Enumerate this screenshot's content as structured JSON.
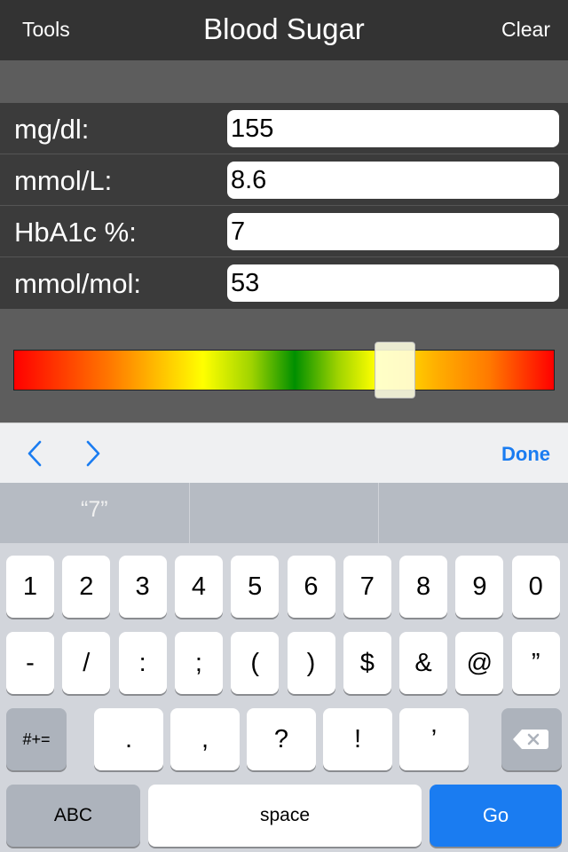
{
  "navbar": {
    "left_label": "Tools",
    "title": "Blood Sugar",
    "right_label": "Clear"
  },
  "rows": [
    {
      "label": "mg/dl:",
      "value": "155"
    },
    {
      "label": "mmol/L:",
      "value": "8.6"
    },
    {
      "label": "HbA1c %:",
      "value": "7"
    },
    {
      "label": "mmol/mol:",
      "value": "53"
    }
  ],
  "gauge": {
    "level_fraction": 0.705
  },
  "accessory": {
    "prev_icon": "chevron-left-icon",
    "next_icon": "chevron-right-icon",
    "done_label": "Done"
  },
  "suggestions": [
    "“7”",
    "",
    ""
  ],
  "keyboard": {
    "row1": [
      "1",
      "2",
      "3",
      "4",
      "5",
      "6",
      "7",
      "8",
      "9",
      "0"
    ],
    "row2": [
      "-",
      "/",
      ":",
      ";",
      "(",
      ")",
      "$",
      "&",
      "@",
      "”"
    ],
    "row3": [
      "#+=",
      ".",
      ",",
      "?",
      "!",
      "’"
    ],
    "delete_icon": "backspace-icon",
    "row4": [
      "ABC",
      "space",
      "Go"
    ]
  },
  "colors": {
    "navbar": "#333333",
    "row_bg": "#3b3b3b",
    "accent": "#1a7cf1"
  }
}
